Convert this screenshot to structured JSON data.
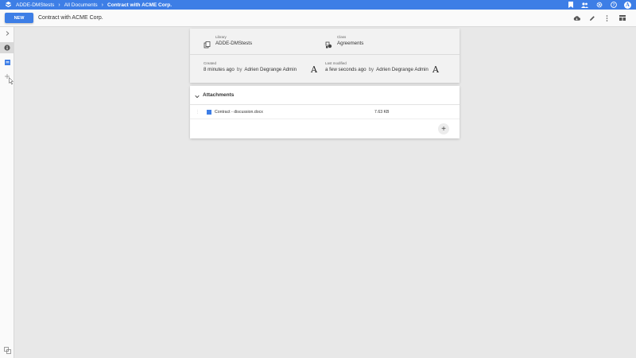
{
  "topbar": {
    "breadcrumbs": [
      "ADDE-DMStests",
      "All Documents",
      "Contract with ACME Corp."
    ],
    "icons": [
      "bookmark-icon",
      "people-icon",
      "settings-icon",
      "help-icon",
      "user-avatar"
    ],
    "avatar_letter": "A"
  },
  "toolbar": {
    "new_label": "NEW",
    "title": "Contract with ACME Corp.",
    "icons": [
      "cloud-download-icon",
      "edit-icon",
      "more-vert-icon",
      "view-toggle-icon"
    ]
  },
  "sidebar": {
    "items": [
      "expand-icon",
      "info-icon",
      "document-icon",
      "add-icon"
    ],
    "footer_icon": "copy-icon"
  },
  "properties": {
    "library": {
      "label": "Library",
      "value": "ADDE-DMStests"
    },
    "class": {
      "label": "Class",
      "value": "Agreements"
    },
    "created": {
      "label": "Created",
      "time": "8 minutes ago",
      "by": "by",
      "user": "Adrien Degrange Admin"
    },
    "modified": {
      "label": "Last modified",
      "time": "a few seconds ago",
      "by": "by",
      "user": "Adrien Degrange Admin"
    },
    "avatar_letter": "A"
  },
  "attachments": {
    "title": "Attachments",
    "items": [
      {
        "handle": "⋮",
        "name": "Contract - discussion.docx",
        "size": "7.63 KB"
      }
    ],
    "add_label": "+"
  },
  "colors": {
    "accent": "#3d7ee6",
    "background": "#e8e8e8"
  }
}
